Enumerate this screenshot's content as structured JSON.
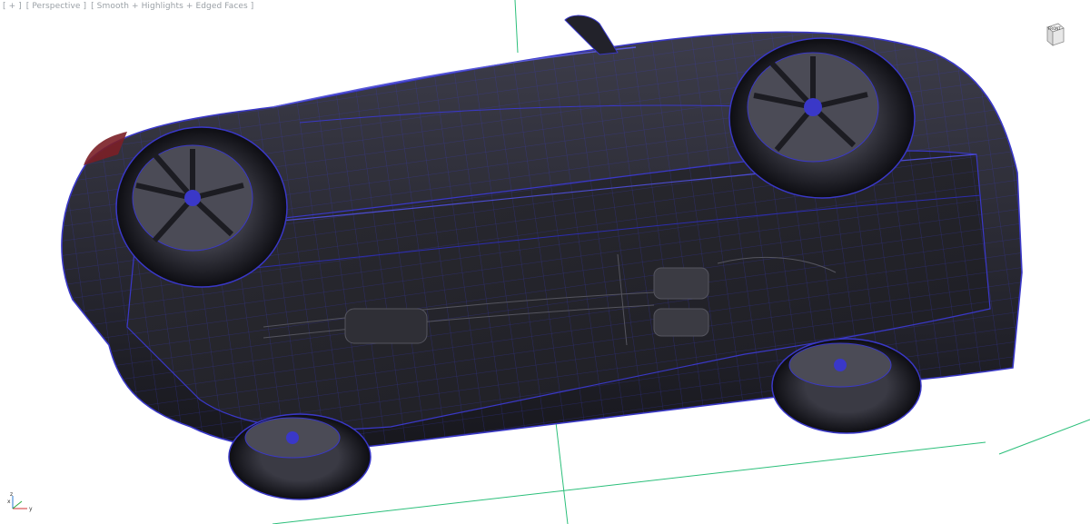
{
  "viewport": {
    "label_segments": [
      "[ + ]",
      "[ Perspective ]",
      "[ Smooth + Highlights + Edged Faces ]"
    ],
    "viewcube_face": "FRONT",
    "axis_labels": {
      "x": "x",
      "y": "y",
      "z": "z"
    }
  },
  "colors": {
    "background": "#ffffff",
    "grid_line": "#2bbf7a",
    "wireframe": "#3a38c8",
    "car_body": "#2a2a34",
    "label_text": "#9aa0a6"
  },
  "icons": [
    "viewcube-icon",
    "axis-tripod-icon"
  ]
}
